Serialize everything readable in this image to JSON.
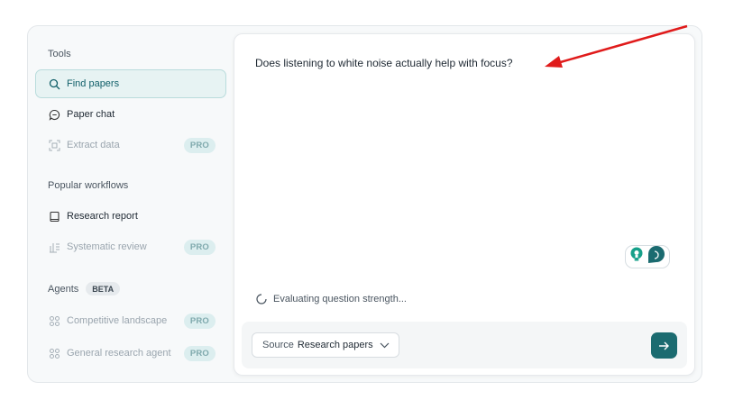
{
  "sidebar": {
    "tools_label": "Tools",
    "tools": [
      {
        "label": "Find papers",
        "icon": "search-icon",
        "active": true
      },
      {
        "label": "Paper chat",
        "icon": "chat-icon"
      },
      {
        "label": "Extract data",
        "icon": "extract-icon",
        "badge": "PRO",
        "disabled": true
      }
    ],
    "workflows_label": "Popular workflows",
    "workflows": [
      {
        "label": "Research report",
        "icon": "book-icon"
      },
      {
        "label": "Systematic review",
        "icon": "review-icon",
        "badge": "PRO",
        "disabled": true
      }
    ],
    "agents_label": "Agents",
    "agents_badge": "BETA",
    "agents": [
      {
        "label": "Competitive landscape",
        "icon": "agent-icon",
        "badge": "PRO",
        "disabled": true
      },
      {
        "label": "General research agent",
        "icon": "agent-icon",
        "badge": "PRO",
        "disabled": true
      }
    ]
  },
  "main": {
    "question": "Does listening to white noise actually help with focus?",
    "status": "Evaluating question strength...",
    "source_label": "Source",
    "source_value": "Research papers"
  },
  "colors": {
    "accent": "#1b6b70",
    "active_bg": "#e7f3f3",
    "pro_badge_bg": "#dceeef",
    "annotation_arrow": "#e01b1b"
  }
}
